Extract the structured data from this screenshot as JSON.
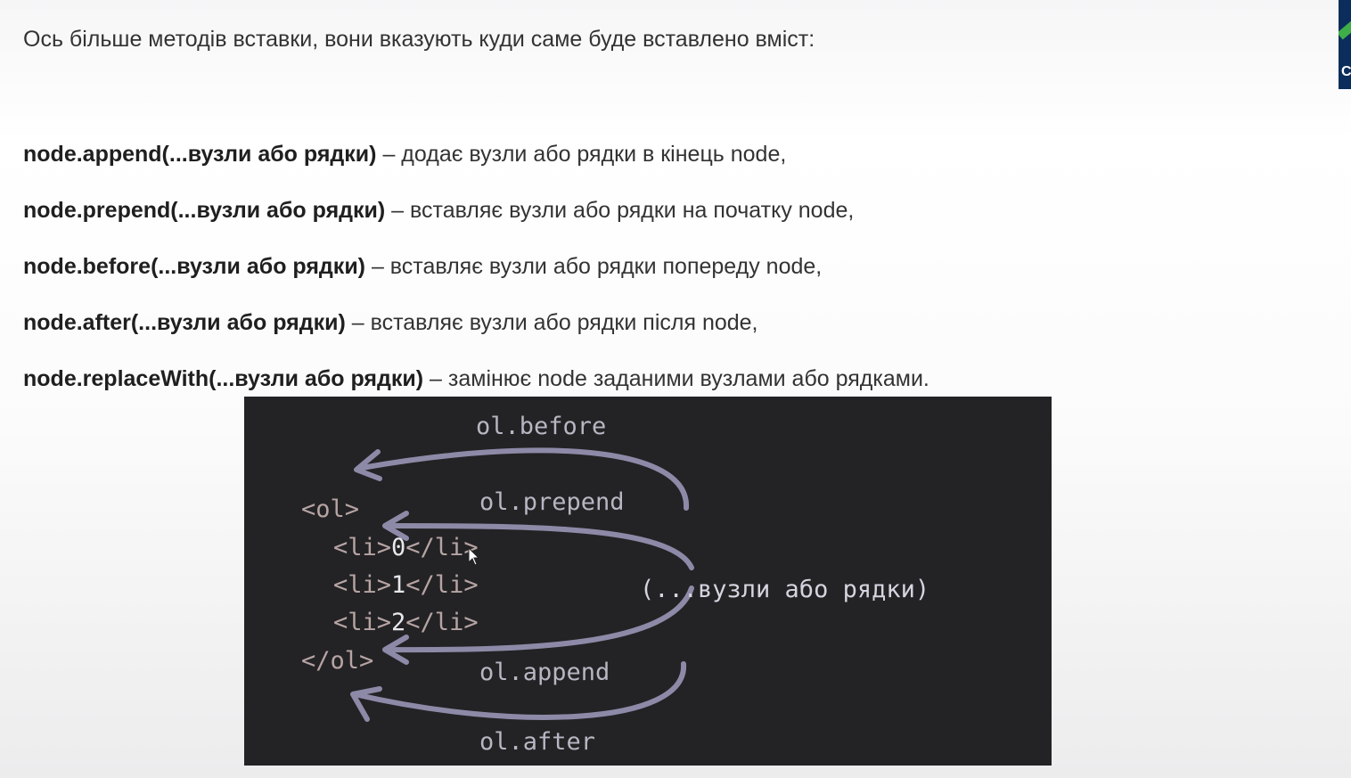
{
  "intro_text": "Ось більше методів вставки, вони вказують куди саме буде вставлено вміст:",
  "methods": [
    {
      "signature": "node.append(...вузли або рядки)",
      "description": " – додає вузли або рядки в кінець node,"
    },
    {
      "signature": "node.prepend(...вузли або рядки)",
      "description": " – вставляє вузли або рядки на початку node,"
    },
    {
      "signature": "node.before(...вузли або рядки)",
      "description": " – вставляє вузли або рядки попереду node,"
    },
    {
      "signature": "node.after(...вузли або рядки)",
      "description": " – вставляє вузли або рядки після node,"
    },
    {
      "signature": "node.replaceWith(...вузли або рядки)",
      "description": " – замінює node заданими вузлами або рядками."
    }
  ],
  "diagram": {
    "labels": {
      "before": "ol.before",
      "prepend": "ol.prepend",
      "append": "ol.append",
      "after": "ol.after",
      "args": "(...вузли або рядки)"
    },
    "code": {
      "ol_open": "<ol>",
      "ol_close": "</ol>",
      "li_open": "<li>",
      "li_close": "</li>",
      "items": [
        "0",
        "1",
        "2"
      ]
    }
  },
  "corner_badge_letter": "C",
  "colors": {
    "diagram_bg": "#232325",
    "arrow": "#8d8aa8",
    "tag": "#b7a4a4",
    "label": "#b8b6c2"
  }
}
